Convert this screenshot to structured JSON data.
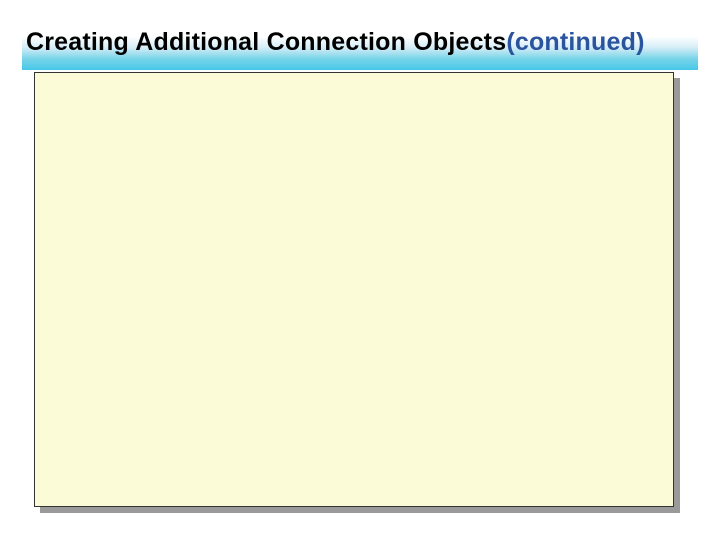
{
  "title": {
    "main": "Creating Additional Connection Objects",
    "suffix": "(continued)"
  }
}
